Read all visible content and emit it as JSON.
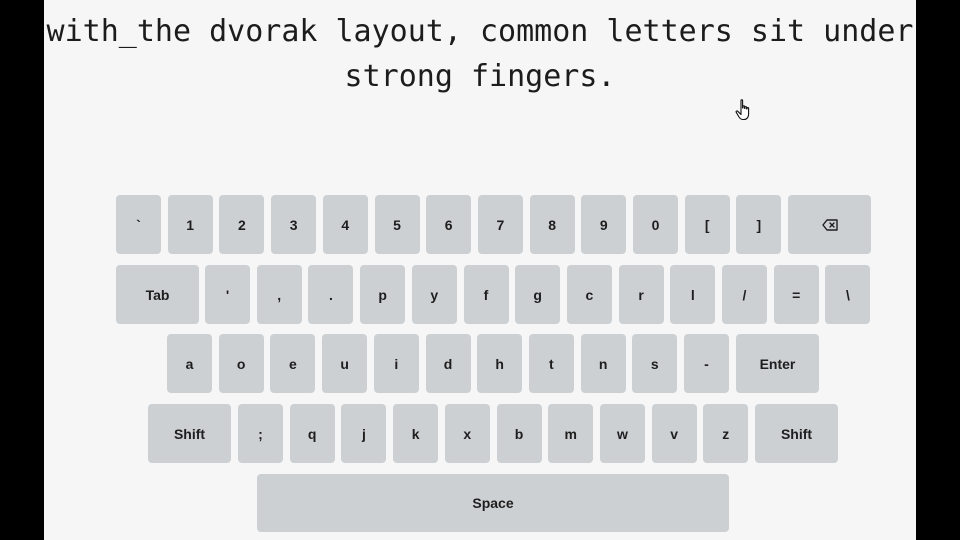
{
  "prompt": {
    "line1": "with_the dvorak layout, common letters sit under",
    "line2": "strong fingers."
  },
  "keyboard": {
    "row1": [
      "`",
      "1",
      "2",
      "3",
      "4",
      "5",
      "6",
      "7",
      "8",
      "9",
      "0",
      "[",
      "]"
    ],
    "backspace_icon": "backspace-icon",
    "row2_tab": "Tab",
    "row2": [
      "'",
      ",",
      ".",
      "p",
      "y",
      "f",
      "g",
      "c",
      "r",
      "l",
      "/",
      "=",
      "\\"
    ],
    "row3": [
      "a",
      "o",
      "e",
      "u",
      "i",
      "d",
      "h",
      "t",
      "n",
      "s",
      "-"
    ],
    "row3_enter": "Enter",
    "row4_shift_left": "Shift",
    "row4": [
      ";",
      "q",
      "j",
      "k",
      "x",
      "b",
      "m",
      "w",
      "v",
      "z"
    ],
    "row4_shift_right": "Shift",
    "space": "Space"
  },
  "colors": {
    "background": "#f6f6f6",
    "key": "#cdd0d3",
    "text": "#1e1e1e",
    "frame": "#000000"
  },
  "cursor_icon": "hand-pointer-icon"
}
